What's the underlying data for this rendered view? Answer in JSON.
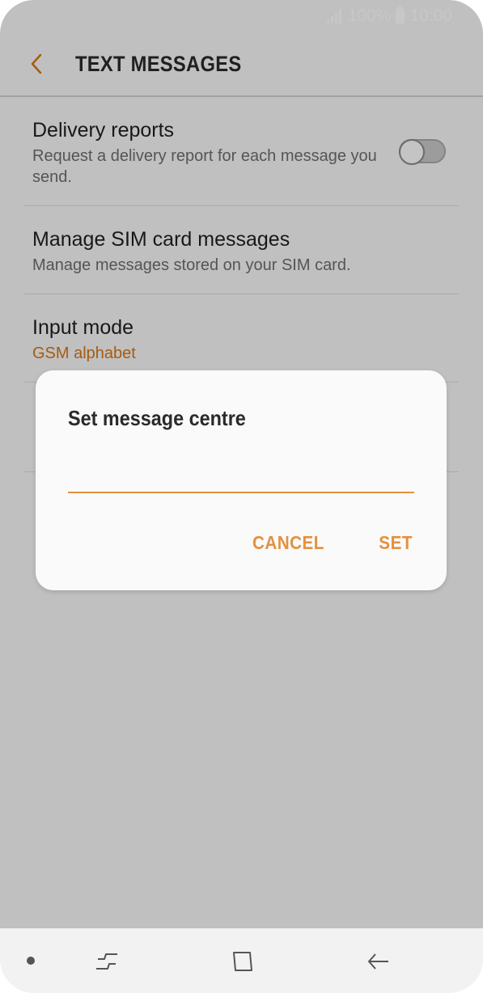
{
  "status_bar": {
    "battery_text": "100%",
    "time": "10:00",
    "icons": [
      "signal-icon",
      "battery-icon"
    ]
  },
  "header": {
    "title": "TEXT MESSAGES",
    "back_icon": "back-arrow-icon"
  },
  "settings": {
    "items": [
      {
        "title": "Delivery reports",
        "subtitle": "Request a delivery report for each message you send.",
        "toggle": "off"
      },
      {
        "title": "Manage SIM card messages",
        "subtitle": "Manage messages stored on your SIM card."
      },
      {
        "title": "Input mode",
        "subtitle": "GSM alphabet"
      }
    ]
  },
  "dialog": {
    "title": "Set message centre",
    "input_value": "",
    "cancel_label": "CANCEL",
    "set_label": "SET"
  },
  "nav_bar": {
    "icons": [
      "recent-apps-icon",
      "home-icon",
      "back-icon"
    ]
  },
  "colors": {
    "accent": "#E3913F",
    "accent_text": "#D57515",
    "title_text": "#1F1F1F",
    "subtitle_text": "#6E6E6E"
  }
}
